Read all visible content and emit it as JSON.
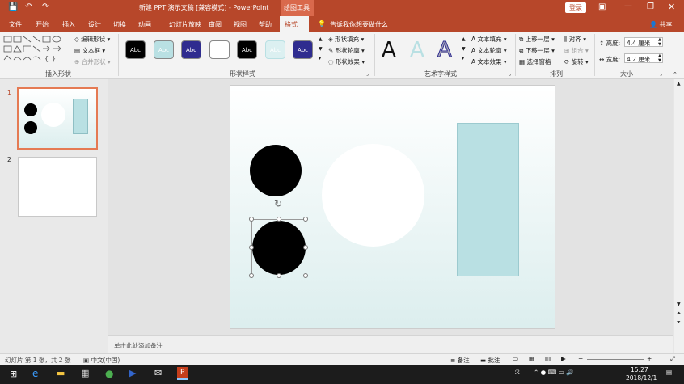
{
  "titlebar": {
    "doc_title": "新建 PPT 演示文稿 [兼容模式] - PowerPoint",
    "tool_tab": "绘图工具",
    "login": "登录"
  },
  "tabs": [
    "文件",
    "开始",
    "插入",
    "设计",
    "切换",
    "动画",
    "幻灯片放映",
    "审阅",
    "视图",
    "帮助",
    "格式"
  ],
  "tellme": "告诉我你想要做什么",
  "share": "共享",
  "ribbon": {
    "insert_shapes": {
      "label": "插入形状",
      "edit_shape": "编辑形状",
      "textbox": "文本框",
      "merge": "合并形状"
    },
    "shape_styles": {
      "label": "形状样式",
      "swatch_text": "Abc",
      "fill": "形状填充",
      "outline": "形状轮廓",
      "effects": "形状效果"
    },
    "wordart": {
      "label": "艺术字样式",
      "letter": "A",
      "text_fill": "文本填充",
      "text_outline": "文本轮廓",
      "text_effects": "文本效果"
    },
    "arrange": {
      "label": "排列",
      "bring_forward": "上移一层",
      "send_backward": "下移一层",
      "selection_pane": "选择窗格",
      "align": "对齐",
      "group": "组合",
      "rotate": "旋转"
    },
    "size": {
      "label": "大小",
      "height_label": "高度:",
      "height": "4.4 厘米",
      "width_label": "宽度:",
      "width": "4.2 厘米"
    }
  },
  "slides": [
    {
      "num": "1"
    },
    {
      "num": "2"
    }
  ],
  "notes_placeholder": "单击此处添加备注",
  "status": {
    "slide_info": "幻灯片 第 1 张，共 2 张",
    "lang": "中文(中国)",
    "notes": "备注",
    "comments": "批注"
  },
  "taskbar": {
    "time": "15:27",
    "date": "2018/12/1"
  },
  "colors": {
    "accent": "#b7472a",
    "swatch_teal": "#b9e0e3",
    "swatch_navy": "#2f2c8f"
  }
}
